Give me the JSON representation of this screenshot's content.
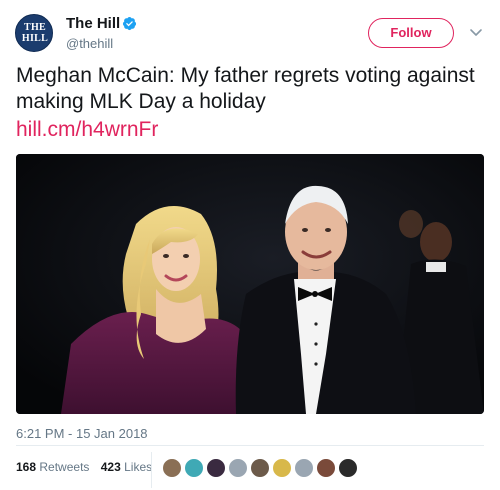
{
  "account": {
    "name": "The Hill",
    "handle": "@thehill",
    "avatar_text_line1": "THE",
    "avatar_text_line2": "HILL"
  },
  "follow_button": {
    "label": "Follow"
  },
  "tweet": {
    "text": "Meghan McCain: My father regrets voting against making MLK Day a holiday",
    "link": "hill.cm/h4wrnFr"
  },
  "meta": {
    "timestamp": "6:21 PM - 15 Jan 2018"
  },
  "stats": {
    "retweets_count": "168",
    "retweets_label": "Retweets",
    "likes_count": "423",
    "likes_label": "Likes"
  },
  "likers": [
    {
      "icon": "user-avatar",
      "color": "#8a6f55"
    },
    {
      "icon": "user-avatar",
      "color": "#3fa9b5"
    },
    {
      "icon": "user-avatar",
      "color": "#3a2a40"
    },
    {
      "icon": "user-avatar",
      "color": "#9aa6b2"
    },
    {
      "icon": "user-avatar",
      "color": "#6c5a4a"
    },
    {
      "icon": "user-avatar",
      "color": "#d8b84a"
    },
    {
      "icon": "user-avatar",
      "color": "#9aa6b2"
    },
    {
      "icon": "user-avatar",
      "color": "#7a4a3a"
    },
    {
      "icon": "user-avatar",
      "color": "#2a2a2a"
    }
  ],
  "colors": {
    "accent": "#e0245e",
    "verified": "#1da1f2",
    "muted": "#657786"
  }
}
